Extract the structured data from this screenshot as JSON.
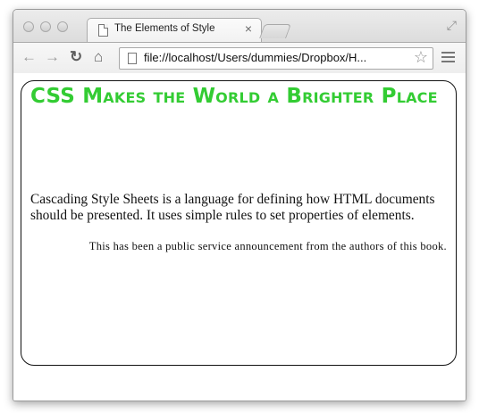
{
  "browser": {
    "tab_title": "The Elements of Style",
    "tab_close": "×",
    "url": "file://localhost/Users/dummies/Dropbox/H...",
    "icons": {
      "back": "back-arrow-icon",
      "forward": "forward-arrow-icon",
      "reload": "reload-icon",
      "home": "home-icon",
      "page": "document-icon",
      "bookmark": "star-icon",
      "menu": "menu-icon",
      "fullscreen": "fullscreen-icon"
    }
  },
  "page": {
    "heading": "CSS Makes the World a Brighter Place",
    "paragraph": "Cascading Style Sheets is a language for defining how HTML documents should be presented. It uses simple rules to set properties of elements.",
    "announcement": "This has been a public service announcement from the authors of this book.",
    "colors": {
      "heading": "#33cc33",
      "border": "#111111"
    }
  }
}
